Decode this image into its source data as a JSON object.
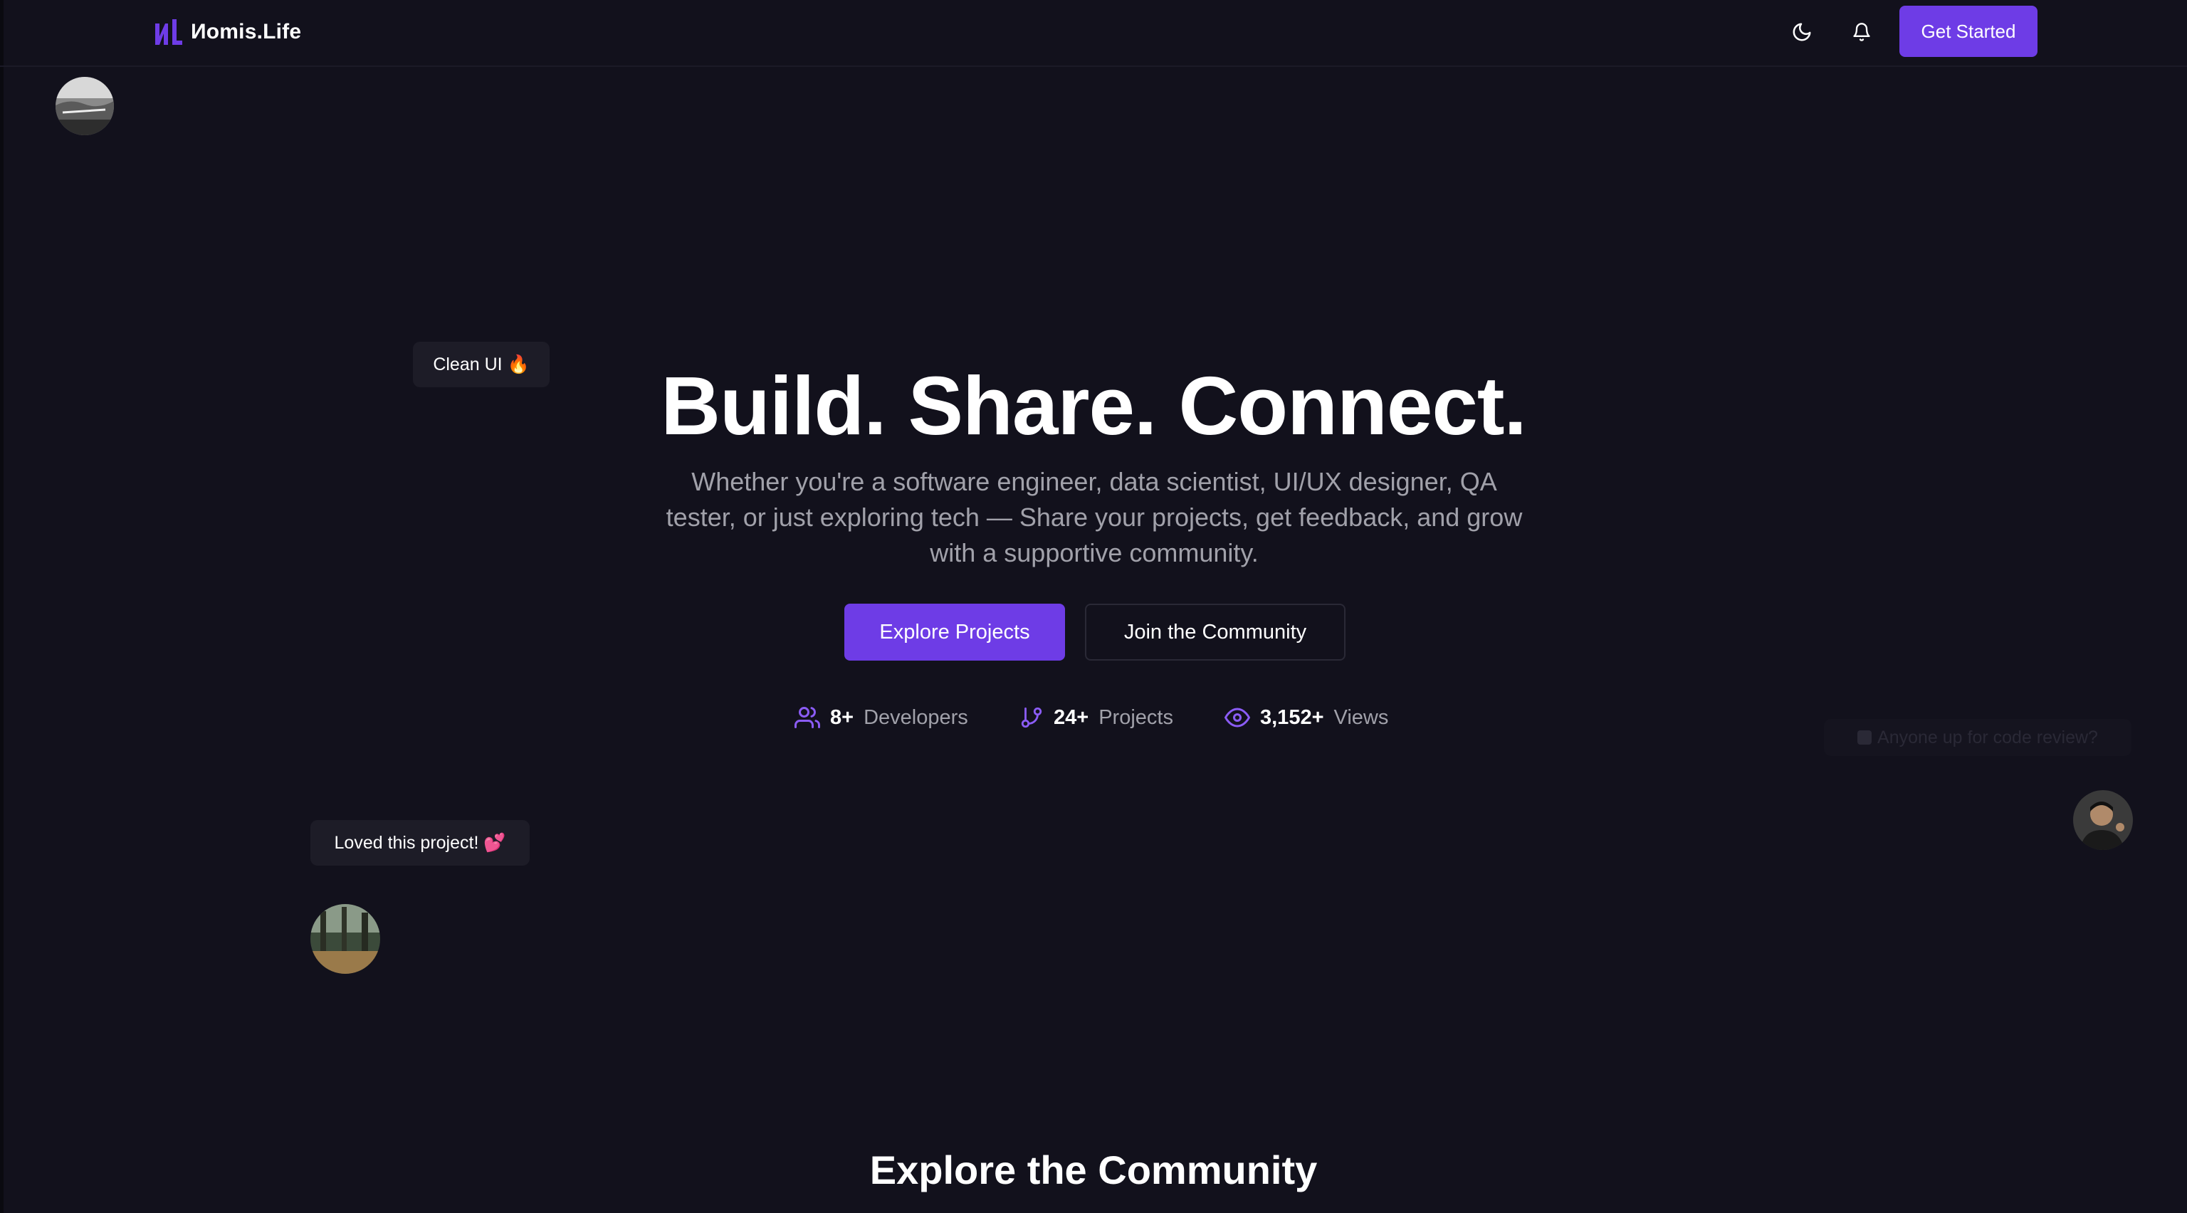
{
  "brand": {
    "name": "Иomis.Life",
    "accent": "#6e3ce6"
  },
  "navbar": {
    "theme_icon": "moon-icon",
    "notifications_icon": "bell-icon",
    "get_started_label": "Get Started"
  },
  "floating": {
    "bubble_clean": "Clean UI 🔥",
    "bubble_loved": "Loved this project! 💕",
    "bubble_faded": "Anyone up for code review?"
  },
  "hero": {
    "title": "Build. Share. Connect.",
    "subtitle": "Whether you're a software engineer, data scientist, UI/UX designer, QA tester, or just exploring tech — Share your projects, get feedback, and grow with a supportive community.",
    "primary_cta": "Explore Projects",
    "secondary_cta": "Join the Community"
  },
  "stats": [
    {
      "icon": "users-icon",
      "value": "8+",
      "label": "Developers"
    },
    {
      "icon": "git-branch-icon",
      "value": "24+",
      "label": "Projects"
    },
    {
      "icon": "eye-icon",
      "value": "3,152+",
      "label": "Views"
    }
  ],
  "sections": {
    "explore_title": "Explore the Community"
  }
}
